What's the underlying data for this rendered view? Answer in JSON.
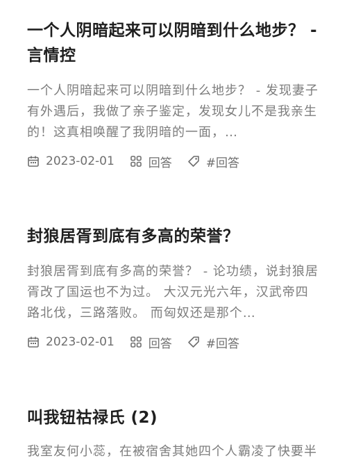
{
  "articles": [
    {
      "title": "一个人阴暗起来可以阴暗到什么地步？ - 言情控",
      "excerpt": "一个人阴暗起来可以阴暗到什么地步？ - 发现妻子有外遇后，我做了亲子鉴定，发现女儿不是我亲生的！这真相唤醒了我阴暗的一面，…",
      "date": "2023-02-01",
      "category": "回答",
      "tag": "#回答",
      "icons": {
        "date": "calendar-icon",
        "category": "grid-icon",
        "tag": "tag-icon"
      }
    },
    {
      "title": "封狼居胥到底有多高的荣誉？",
      "excerpt": "封狼居胥到底有多高的荣誉？ - 论功绩，说封狼居胥改了国运也不为过。 大汉元光六年，汉武帝四路北伐，三路落败。 而匈奴还是那个…",
      "date": "2023-02-01",
      "category": "回答",
      "tag": "#回答",
      "icons": {
        "date": "calendar-icon",
        "category": "grid-icon",
        "tag": "tag-icon"
      }
    },
    {
      "title": "叫我钮祜禄氏 (2)",
      "excerpt": "我室友何小蕊，在被宿舍其她四个人霸凌了快要半年之后，终于，迎来了她们的反击。"
    }
  ],
  "colors": {
    "title": "#1f1f1f",
    "excerpt": "#7d7d7d",
    "meta": "#6f6f6f",
    "background": "#ffffff"
  }
}
